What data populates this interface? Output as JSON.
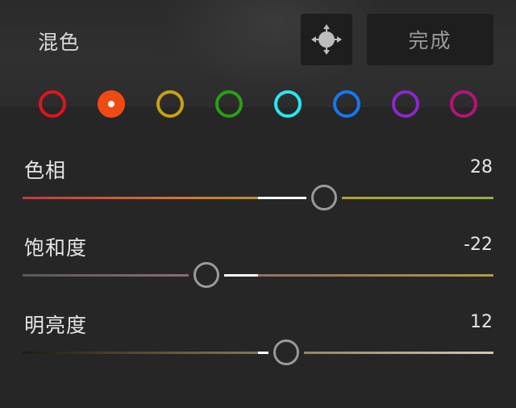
{
  "header": {
    "title": "混色",
    "done_label": "完成",
    "target_icon": "target-adjust-icon"
  },
  "colors": [
    {
      "name": "red",
      "hex": "#e0141e",
      "selected": false
    },
    {
      "name": "orange",
      "hex": "#f04a14",
      "selected": true
    },
    {
      "name": "yellow",
      "hex": "#c8a012",
      "selected": false
    },
    {
      "name": "green",
      "hex": "#28a014",
      "selected": false
    },
    {
      "name": "aqua",
      "hex": "#28e6f0",
      "selected": false
    },
    {
      "name": "blue",
      "hex": "#1478f0",
      "selected": false
    },
    {
      "name": "purple",
      "hex": "#8c28c8",
      "selected": false
    },
    {
      "name": "magenta",
      "hex": "#b4147a",
      "selected": false
    }
  ],
  "sliders": [
    {
      "label": "色相",
      "value": "28",
      "level": 28,
      "min": -100,
      "max": 100,
      "gradient": [
        "#c23a3a",
        "#d2782e",
        "#b0a030",
        "#8cb43c"
      ]
    },
    {
      "label": "饱和度",
      "value": "-22",
      "level": -22,
      "min": -100,
      "max": 100,
      "gradient": [
        "#5a5a5a",
        "#8a6a7a",
        "#9a7a5a",
        "#b09a50"
      ]
    },
    {
      "label": "明亮度",
      "value": "12",
      "level": 12,
      "min": -100,
      "max": 100,
      "gradient": [
        "#1e1a14",
        "#6a5a3a",
        "#a09070",
        "#d2c8b0"
      ]
    }
  ]
}
